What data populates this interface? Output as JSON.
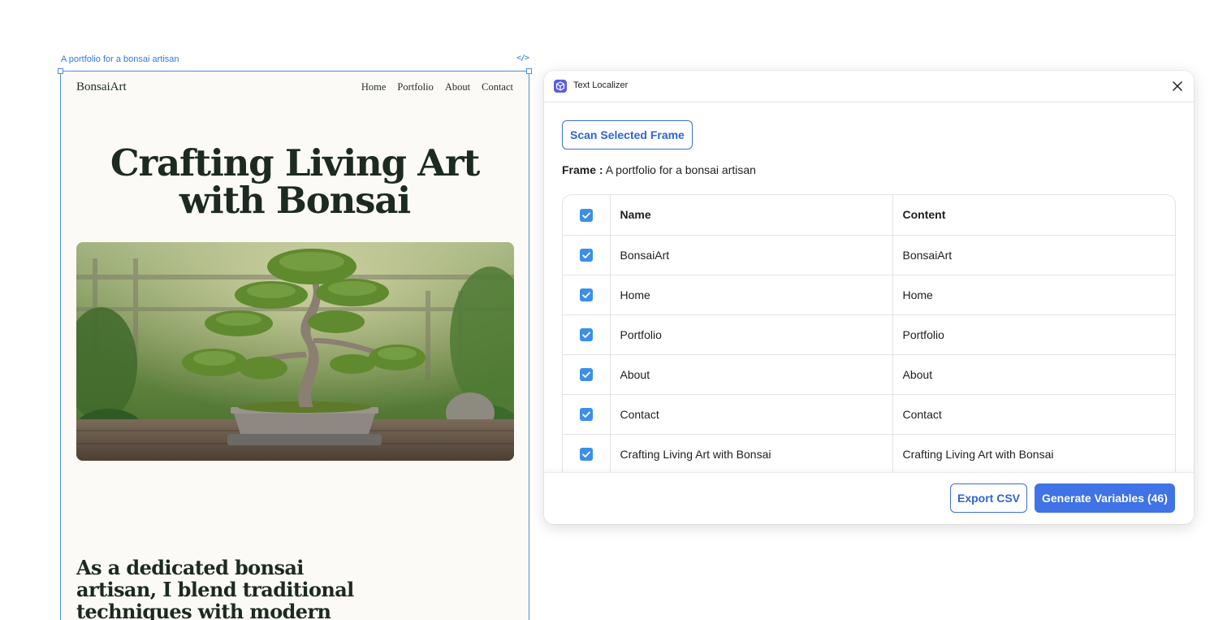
{
  "canvas": {
    "frame_label": "A portfolio for a bonsai artisan",
    "code_icon": "code-icon"
  },
  "site": {
    "logo": "BonsaiArt",
    "nav": [
      "Home",
      "Portfolio",
      "About",
      "Contact"
    ],
    "hero_title": "Crafting Living Art with Bonsai",
    "hero_image": "bonsai-tree-photo",
    "intro": "As a dedicated bonsai artisan, I blend traditional techniques with modern"
  },
  "panel": {
    "title": "Text Localizer",
    "icon": "plugin-cube-icon",
    "close_icon": "close-icon",
    "scan_button": "Scan Selected Frame",
    "frame_label": "Frame :",
    "frame_name": "A portfolio for a bonsai artisan",
    "table": {
      "headers": {
        "name": "Name",
        "content": "Content"
      },
      "rows": [
        {
          "name": "BonsaiArt",
          "content": "BonsaiArt",
          "checked": true
        },
        {
          "name": "Home",
          "content": "Home",
          "checked": true
        },
        {
          "name": "Portfolio",
          "content": "Portfolio",
          "checked": true
        },
        {
          "name": "About",
          "content": "About",
          "checked": true
        },
        {
          "name": "Contact",
          "content": "Contact",
          "checked": true
        },
        {
          "name": "Crafting Living Art with Bonsai",
          "content": "Crafting Living Art with Bonsai",
          "checked": true
        }
      ]
    },
    "export_button": "Export CSV",
    "generate_button": "Generate Variables (46)"
  },
  "colors": {
    "accent": "#3f73e6",
    "checkbox": "#3b8fe8",
    "selection": "#4a90e2",
    "plugin_icon": "#5b5ce2"
  }
}
